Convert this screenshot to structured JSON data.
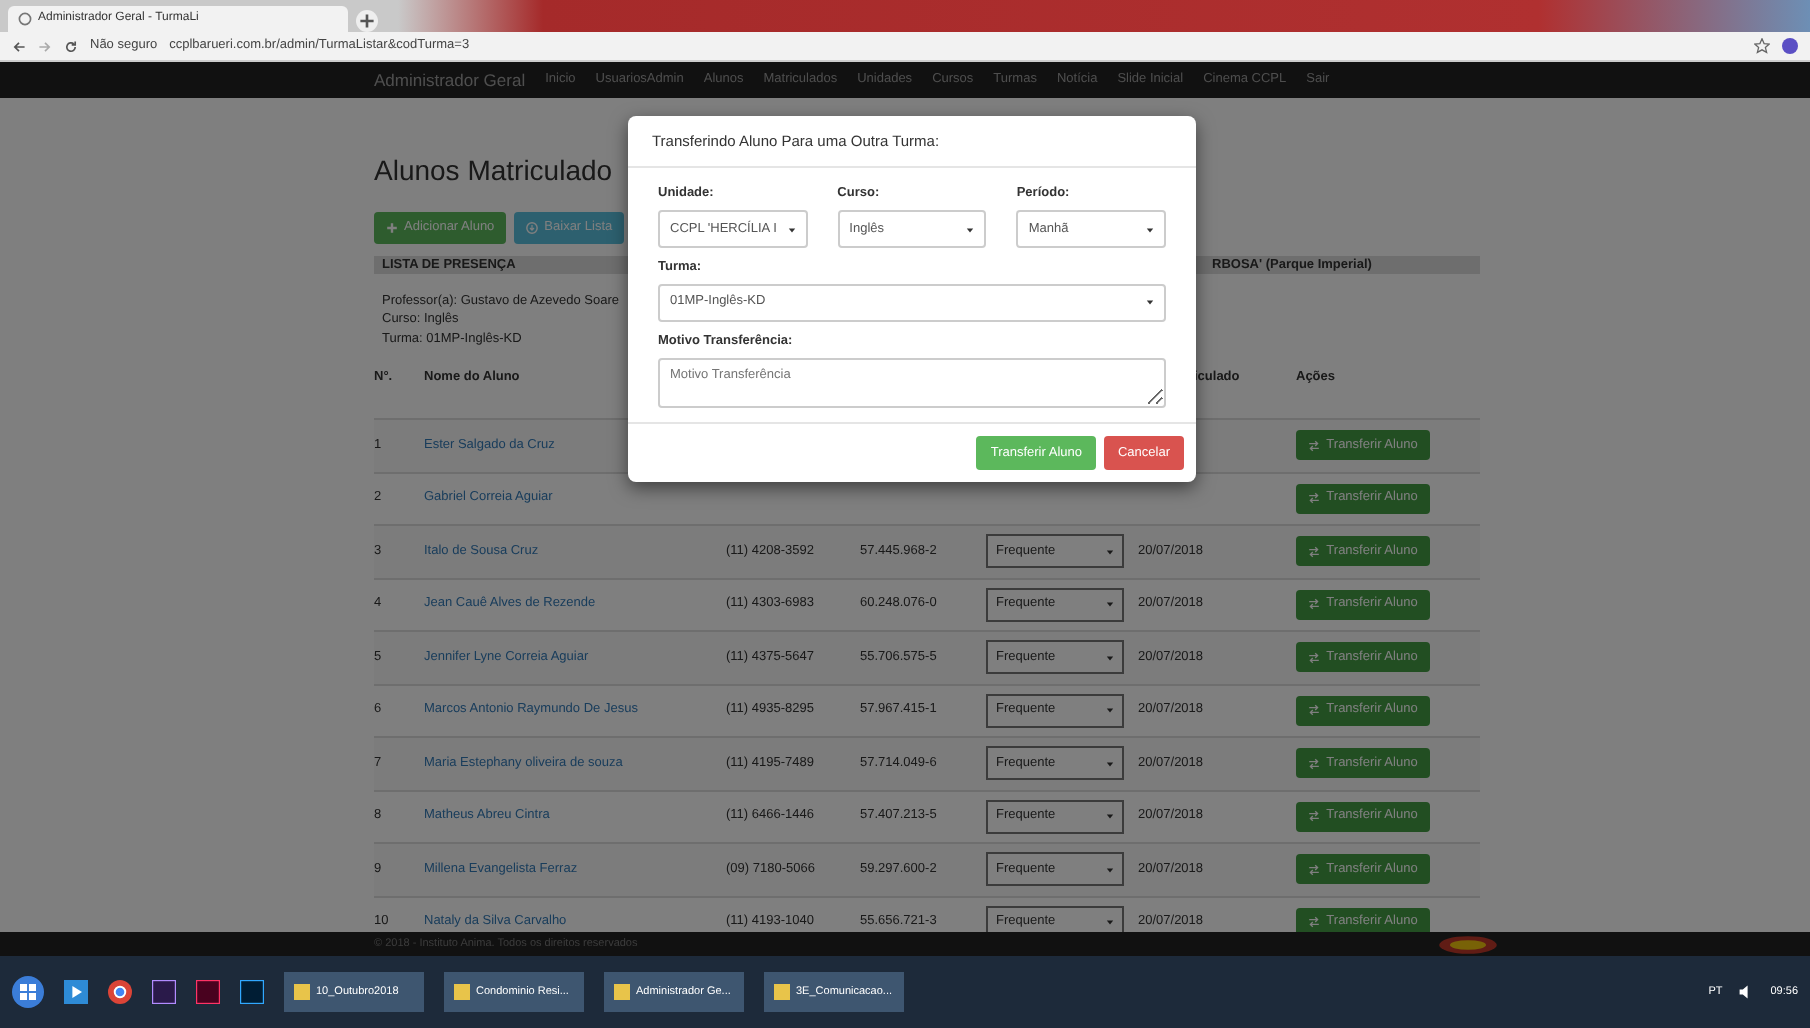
{
  "browser": {
    "tab_title": "Administrador Geral - TurmaLi",
    "security": "Não seguro",
    "address": "ccplbarueri.com.br/admin/TurmaListar&codTurma=3"
  },
  "navbar": {
    "brand": "Administrador Geral",
    "links": [
      "Inicio",
      "UsuariosAdmin",
      "Alunos",
      "Matriculados",
      "Unidades",
      "Cursos",
      "Turmas",
      "Notícia",
      "Slide Inicial",
      "Cinema CCPL",
      "Sair"
    ]
  },
  "page": {
    "heading": "Alunos Matriculado",
    "buttons": [
      {
        "label": "Adicionar Aluno",
        "kind": "add"
      },
      {
        "label": "Baixar Lista",
        "kind": "download"
      }
    ],
    "panel": {
      "title": "LISTA DE PRESENÇA",
      "unit_fragment": "RBOSA' (Parque Imperial)",
      "info": [
        "Professor(a): Gustavo de Azevedo Soare",
        "Curso: Inglês",
        "Turma: 01MP-Inglês-KD"
      ]
    },
    "table": {
      "columns": {
        "column_1": "N°.",
        "column_2": "Nome do Aluno",
        "column_6": "iculado",
        "column_7": "Ações"
      },
      "rows": [
        {
          "number": "1",
          "name": "Ester Salgado da Cruz",
          "action": "Transferir Aluno"
        },
        {
          "number": "2",
          "name": "Gabriel Correia Aguiar",
          "action": "Transferir Aluno"
        },
        {
          "number": "3",
          "name": "Italo de Sousa Cruz",
          "phone": "(11) 4208-3592",
          "rg": "57.445.968-2",
          "status": "Frequente",
          "date": "20/07/2018",
          "action": "Transferir Aluno"
        },
        {
          "number": "4",
          "name": "Jean Cauê Alves de Rezende",
          "phone": "(11) 4303-6983",
          "rg": "60.248.076-0",
          "status": "Frequente",
          "date": "20/07/2018",
          "action": "Transferir Aluno"
        },
        {
          "number": "5",
          "name": "Jennifer Lyne Correia Aguiar",
          "phone": "(11) 4375-5647",
          "rg": "55.706.575-5",
          "status": "Frequente",
          "date": "20/07/2018",
          "action": "Transferir Aluno"
        },
        {
          "number": "6",
          "name": "Marcos Antonio Raymundo De Jesus",
          "phone": "(11) 4935-8295",
          "rg": "57.967.415-1",
          "status": "Frequente",
          "date": "20/07/2018",
          "action": "Transferir Aluno"
        },
        {
          "number": "7",
          "name": "Maria Estephany oliveira de souza",
          "phone": "(11) 4195-7489",
          "rg": "57.714.049-6",
          "status": "Frequente",
          "date": "20/07/2018",
          "action": "Transferir Aluno"
        },
        {
          "number": "8",
          "name": "Matheus Abreu Cintra",
          "phone": "(11) 6466-1446",
          "rg": "57.407.213-5",
          "status": "Frequente",
          "date": "20/07/2018",
          "action": "Transferir Aluno"
        },
        {
          "number": "9",
          "name": "Millena Evangelista Ferraz",
          "phone": "(09) 7180-5066",
          "rg": "59.297.600-2",
          "status": "Frequente",
          "date": "20/07/2018",
          "action": "Transferir Aluno"
        },
        {
          "number": "10",
          "name": "Nataly da Silva Carvalho",
          "phone": "(11) 4193-1040",
          "rg": "55.656.721-3",
          "status": "Frequente",
          "date": "20/07/2018",
          "action": "Transferir Aluno"
        }
      ]
    },
    "footer": "© 2018 - Instituto Anima. Todos os direitos reservados"
  },
  "modal": {
    "title": "Transferindo Aluno Para uma Outra Turma:",
    "fields": [
      {
        "label": "Unidade:",
        "value": "CCPL 'HERCÍLIA I"
      },
      {
        "label": "Curso:",
        "value": "Inglês"
      },
      {
        "label": "Período:",
        "value": "Manhã"
      }
    ],
    "turma": {
      "label": "Turma:",
      "value": "01MP-Inglês-KD"
    },
    "reason": {
      "label": "Motivo Transferência:",
      "placeholder": "Motivo Transferência"
    },
    "buttons": [
      {
        "label": "Transferir Aluno",
        "kind": "confirm"
      },
      {
        "label": "Cancelar",
        "kind": "cancel"
      }
    ]
  },
  "taskbar": {
    "items": [
      "10_Outubro2018",
      "Condominio Resi...",
      "Administrador Ge...",
      "3E_Comunicacao..."
    ],
    "language": "PT",
    "time": "09:56"
  }
}
